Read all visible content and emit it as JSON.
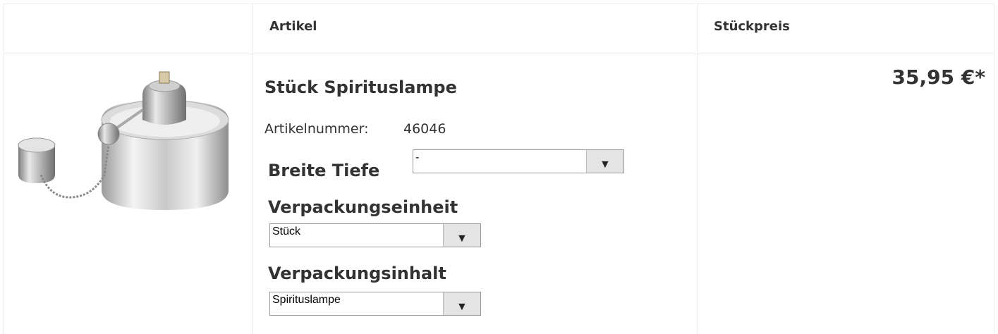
{
  "header": {
    "col_article": "Artikel",
    "col_unit_price": "Stückpreis"
  },
  "product": {
    "title": "Stück Spirituslampe",
    "article_number_label": "Artikelnummer:",
    "article_number": "46046",
    "image_icon": "spirit-lamp-image",
    "price": "35,95 €*"
  },
  "options": {
    "breite_tiefe": {
      "label": "Breite Tiefe",
      "value": "-"
    },
    "verpackungseinheit": {
      "label": "Verpackungseinheit",
      "value": "Stück"
    },
    "verpackungsinhalt": {
      "label": "Verpackungsinhalt",
      "value": "Spirituslampe"
    }
  },
  "dropdown_arrow": "▼"
}
